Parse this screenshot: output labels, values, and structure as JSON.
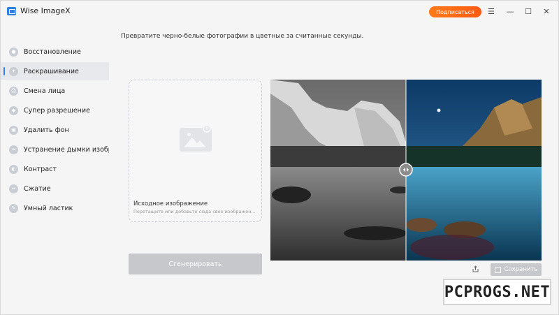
{
  "app": {
    "title": "Wise ImageX",
    "subscribe_label": "Подписаться",
    "colors": {
      "accent": "#ff6a13",
      "brand": "#2f7fe0"
    }
  },
  "sidebar": {
    "items": [
      {
        "label": "Восстановление",
        "icon": "restore-icon",
        "active": false
      },
      {
        "label": "Раскрашивание",
        "icon": "colorize-icon",
        "active": true
      },
      {
        "label": "Смена лица",
        "icon": "face-swap-icon",
        "active": false
      },
      {
        "label": "Супер разрешение",
        "icon": "super-resolution-icon",
        "active": false
      },
      {
        "label": "Удалить фон",
        "icon": "remove-background-icon",
        "active": false
      },
      {
        "label": "Устранение дымки изображ",
        "icon": "dehaze-icon",
        "active": false
      },
      {
        "label": "Контраст",
        "icon": "contrast-icon",
        "active": false
      },
      {
        "label": "Сжатие",
        "icon": "compress-icon",
        "active": false
      },
      {
        "label": "Умный ластик",
        "icon": "smart-eraser-icon",
        "active": false
      }
    ]
  },
  "main": {
    "instruction": "Превратите черно-белые фотографии в цветные за считанные секунды.",
    "upload": {
      "title": "Исходное изображение",
      "hint": "Перетащите или добавьте сюда свое изображен..."
    },
    "generate_label": "Сгенерировать",
    "save_label": "Сохранить"
  },
  "watermark": "PCPROGS.NET"
}
